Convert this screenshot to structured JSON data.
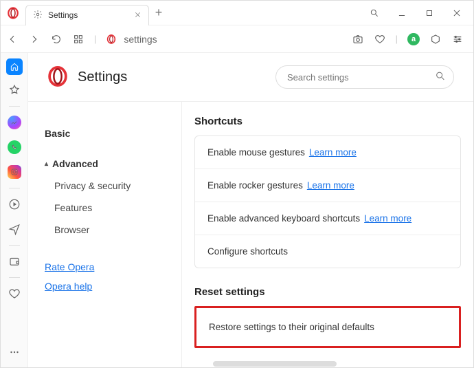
{
  "titlebar": {
    "tab_title": "Settings",
    "new_tab_label": "+"
  },
  "addressbar": {
    "url_text": "settings"
  },
  "page": {
    "title": "Settings",
    "search_placeholder": "Search settings"
  },
  "nav": {
    "basic": "Basic",
    "advanced": "Advanced",
    "privacy": "Privacy & security",
    "features": "Features",
    "browser": "Browser",
    "rate": "Rate Opera",
    "help": "Opera help"
  },
  "sections": {
    "shortcuts": {
      "title": "Shortcuts",
      "rows": {
        "mouse": "Enable mouse gestures",
        "rocker": "Enable rocker gestures",
        "keyboard": "Enable advanced keyboard shortcuts",
        "configure": "Configure shortcuts",
        "learn_more": "Learn more"
      }
    },
    "reset": {
      "title": "Reset settings",
      "restore": "Restore settings to their original defaults"
    }
  },
  "colors": {
    "link": "#1a73e8",
    "highlight_border": "#d92020",
    "accent_home": "#0a84ff"
  }
}
